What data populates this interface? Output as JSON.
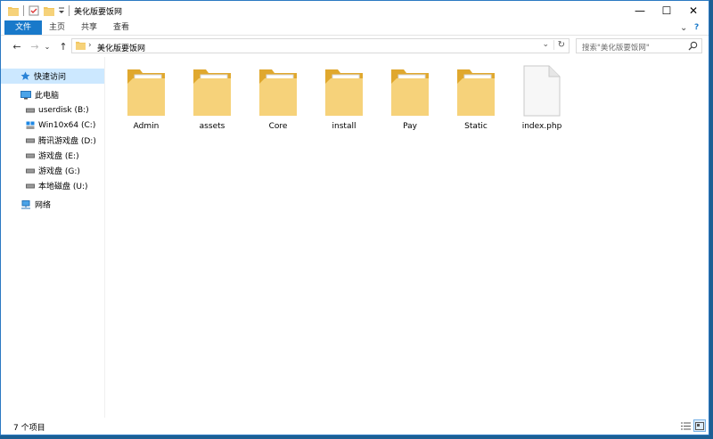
{
  "window": {
    "title": "美化版要饭网",
    "controls": {
      "minimize": "—",
      "maximize": "☐",
      "close": "✕"
    }
  },
  "ribbon": {
    "tabs": [
      "文件",
      "主页",
      "共享",
      "查看"
    ],
    "collapse_glyph": "⌄",
    "help_glyph": "?"
  },
  "address": {
    "path": "美化版要饭网",
    "chevron": "›",
    "dropdown_glyph": "⌄",
    "refresh_glyph": "↻",
    "back_glyph": "←",
    "forward_glyph": "→",
    "recent_glyph": "⌄",
    "up_glyph": "↑"
  },
  "search": {
    "placeholder": "搜索\"美化版要饭网\""
  },
  "nav": {
    "quick_access": "快速访问",
    "this_pc": "此电脑",
    "drives": [
      {
        "label": "userdisk (B:)"
      },
      {
        "label": "Win10x64 (C:)"
      },
      {
        "label": "腾讯游戏盘 (D:)"
      },
      {
        "label": "游戏盘 (E:)"
      },
      {
        "label": "游戏盘 (G:)"
      },
      {
        "label": "本地磁盘 (U:)"
      }
    ],
    "network": "网络"
  },
  "items": [
    {
      "name": "Admin",
      "type": "folder"
    },
    {
      "name": "assets",
      "type": "folder"
    },
    {
      "name": "Core",
      "type": "folder"
    },
    {
      "name": "install",
      "type": "folder"
    },
    {
      "name": "Pay",
      "type": "folder"
    },
    {
      "name": "Static",
      "type": "folder"
    },
    {
      "name": "index.php",
      "type": "file"
    }
  ],
  "status": {
    "count_text": "7 个项目"
  },
  "colors": {
    "accent": "#1979ca",
    "selection": "#cce8ff",
    "folder": "#f2c55c",
    "folder_dark": "#e0a82e"
  }
}
